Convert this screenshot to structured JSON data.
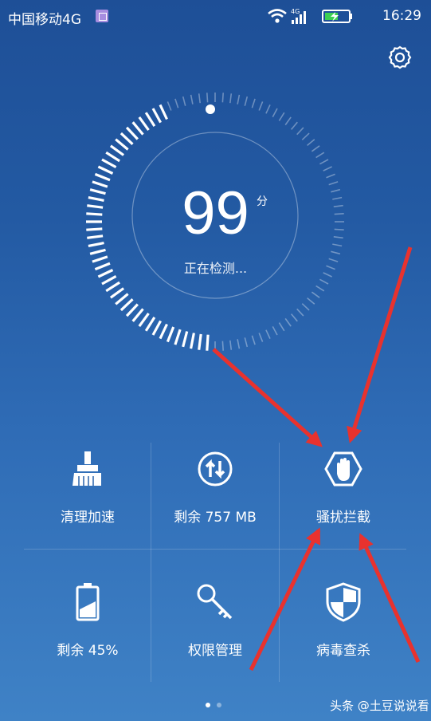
{
  "status_bar": {
    "carrier": "中国移动4G",
    "network_badge": "4G",
    "time": "16:29",
    "icons": [
      "sim-badge-icon",
      "wifi-icon",
      "signal-icon",
      "battery-charging-icon"
    ]
  },
  "header": {
    "settings_icon": "gear-icon"
  },
  "scan": {
    "score": "99",
    "score_unit": "分",
    "status": "正在检测..."
  },
  "tiles": [
    {
      "label": "清理加速",
      "icon": "broom-icon"
    },
    {
      "label": "剩余 757 MB",
      "icon": "memory-arrows-icon"
    },
    {
      "label": "骚扰拦截",
      "icon": "hand-block-icon"
    },
    {
      "label": "剩余 45%",
      "icon": "battery-icon"
    },
    {
      "label": "权限管理",
      "icon": "key-icon"
    },
    {
      "label": "病毒查杀",
      "icon": "shield-icon"
    }
  ],
  "battery_level": 0.45,
  "pager": {
    "current": 1,
    "total": 2
  },
  "watermark": "头条 @土豆说说看",
  "colors": {
    "arrow": "#e8322e",
    "background_top": "#1e4f97",
    "background_bottom": "#3f82c6"
  }
}
